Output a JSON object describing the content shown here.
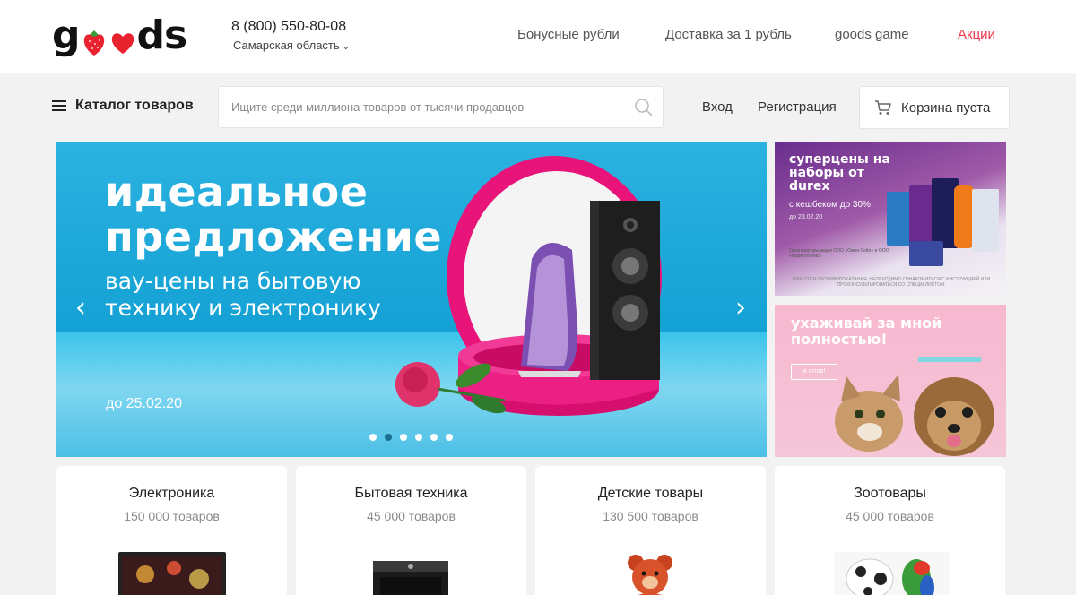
{
  "header": {
    "logo_text": "goods",
    "phone": "8 (800) 550-80-08",
    "region": "Самарская область",
    "links": {
      "bonus": "Бонусные рубли",
      "delivery": "Доставка за 1 рубль",
      "game": "goods game",
      "promo": "Акции"
    }
  },
  "nav": {
    "catalog_label": "Каталог товаров",
    "search_placeholder": "Ищите среди миллиона товаров от тысячи продавцов",
    "login": "Вход",
    "register": "Регистрация",
    "cart_label": "Корзина пуста"
  },
  "hero": {
    "title_line1": "идеальное",
    "title_line2": "предложение",
    "subtitle_line1": "вау-цены на бытовую",
    "subtitle_line2": "технику и электронику",
    "date": "до 25.02.20",
    "prev_arrow": "‹",
    "next_arrow": "›",
    "slide_count": 6,
    "active_slide": 2
  },
  "side_banners": {
    "durex": {
      "title": "суперцены на наборы от durex",
      "subtitle": "с кешбеком до 30%",
      "date": "до 23.02.20",
      "legal": "Организаторы акции ООО «Омни Сейл» и ООО «Маркетплейс»",
      "warning": "ИМЕЮТСЯ ПРОТИВОПОКАЗАНИЯ. НЕОБХОДИМО ОЗНАКОМИТЬСЯ С ИНСТРУКЦИЕЙ ИЛИ ПРОКОНСУЛЬТИРОВАТЬСЯ СО СПЕЦИАЛИСТОМ."
    },
    "pets": {
      "title": "ухаживай за мной полностью!",
      "button": "я готов!"
    }
  },
  "categories": [
    {
      "title": "Электроника",
      "count": "150 000 товаров"
    },
    {
      "title": "Бытовая техника",
      "count": "45 000 товаров"
    },
    {
      "title": "Детские товары",
      "count": "130 500 товаров"
    },
    {
      "title": "Зоотовары",
      "count": "45 000 товаров"
    }
  ],
  "colors": {
    "accent_red": "#f0384a",
    "hero_blue": "#14a1d4",
    "background": "#f2f2f2"
  }
}
